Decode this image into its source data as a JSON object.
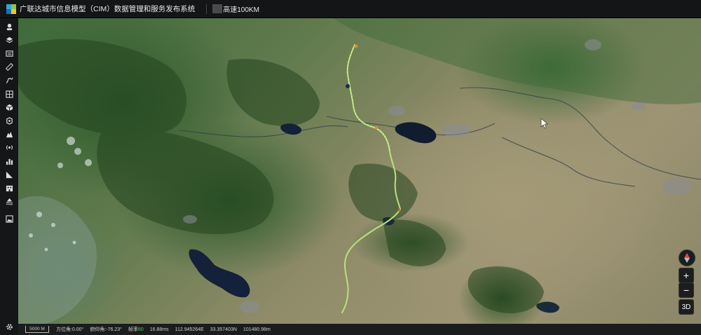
{
  "header": {
    "title": "广联达城市信息模型（CIM）数据管理和服务发布系统",
    "active_layer": "高速100KM"
  },
  "sidebar": {
    "items": [
      {
        "icon": "camera-position-icon"
      },
      {
        "icon": "layers-icon"
      },
      {
        "icon": "scene-panel-icon"
      },
      {
        "icon": "ruler-measure-icon"
      },
      {
        "icon": "draw-line-icon"
      },
      {
        "icon": "grid-table-icon"
      },
      {
        "icon": "model-cube-icon"
      },
      {
        "icon": "box-model-icon"
      },
      {
        "icon": "terrain-analysis-icon"
      },
      {
        "icon": "signal-radar-icon"
      },
      {
        "icon": "bar-chart-icon"
      },
      {
        "icon": "slope-analysis-icon"
      },
      {
        "icon": "building-icon"
      },
      {
        "icon": "flood-analysis-icon"
      },
      {
        "icon": "image-icon"
      }
    ],
    "settings_icon": "gear-icon"
  },
  "map_controls": {
    "compass": "compass-icon",
    "zoom_in": "+",
    "zoom_out": "−",
    "mode": "3D"
  },
  "status": {
    "scale": "5000 M",
    "heading": "方位角:0.00°",
    "pitch": "俯仰角:-76.23°",
    "fps_label": "帧率",
    "fps_value": "60",
    "frame_time": "16.88ms",
    "longitude": "112.945264E",
    "latitude": "33.357403N",
    "height": "101480.98m"
  },
  "colors": {
    "topbar_bg": "#131516",
    "route_main": "#b6e27a",
    "fps_ok": "#4fd14f"
  }
}
